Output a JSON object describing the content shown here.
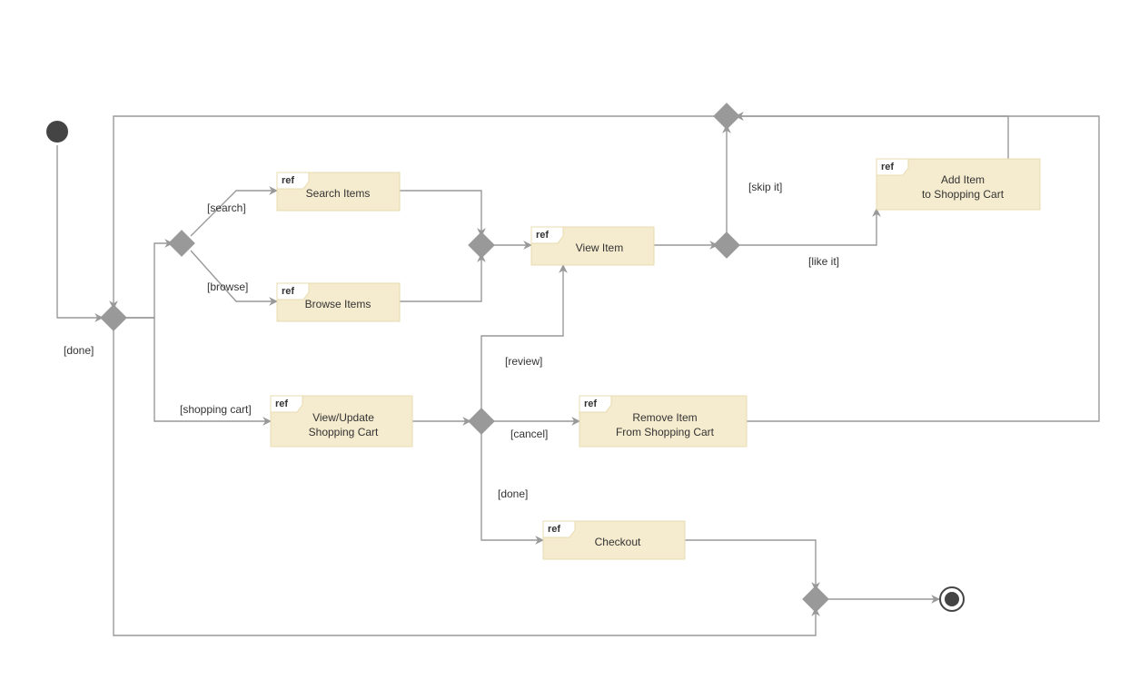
{
  "diagram": {
    "refTag": "ref",
    "nodes": {
      "searchItems": "Search Items",
      "browseItems": "Browse Items",
      "viewItem": "View Item",
      "addItem1": "Add Item",
      "addItem2": "to Shopping Cart",
      "viewUpdate1": "View/Update",
      "viewUpdate2": "Shopping Cart",
      "removeItem1": "Remove Item",
      "removeItem2": "From Shopping Cart",
      "checkout": "Checkout"
    },
    "guards": {
      "search": "[search]",
      "browse": "[browse]",
      "shoppingCart": "[shopping cart]",
      "review": "[review]",
      "cancel": "[cancel]",
      "doneInner": "[done]",
      "doneOuter": "[done]",
      "skipIt": "[skip it]",
      "likeIt": "[like it]"
    },
    "colors": {
      "nodeFill": "#f5ebce",
      "nodeStroke": "#e8dbb0",
      "edge": "#999999",
      "initial": "#444444"
    }
  }
}
